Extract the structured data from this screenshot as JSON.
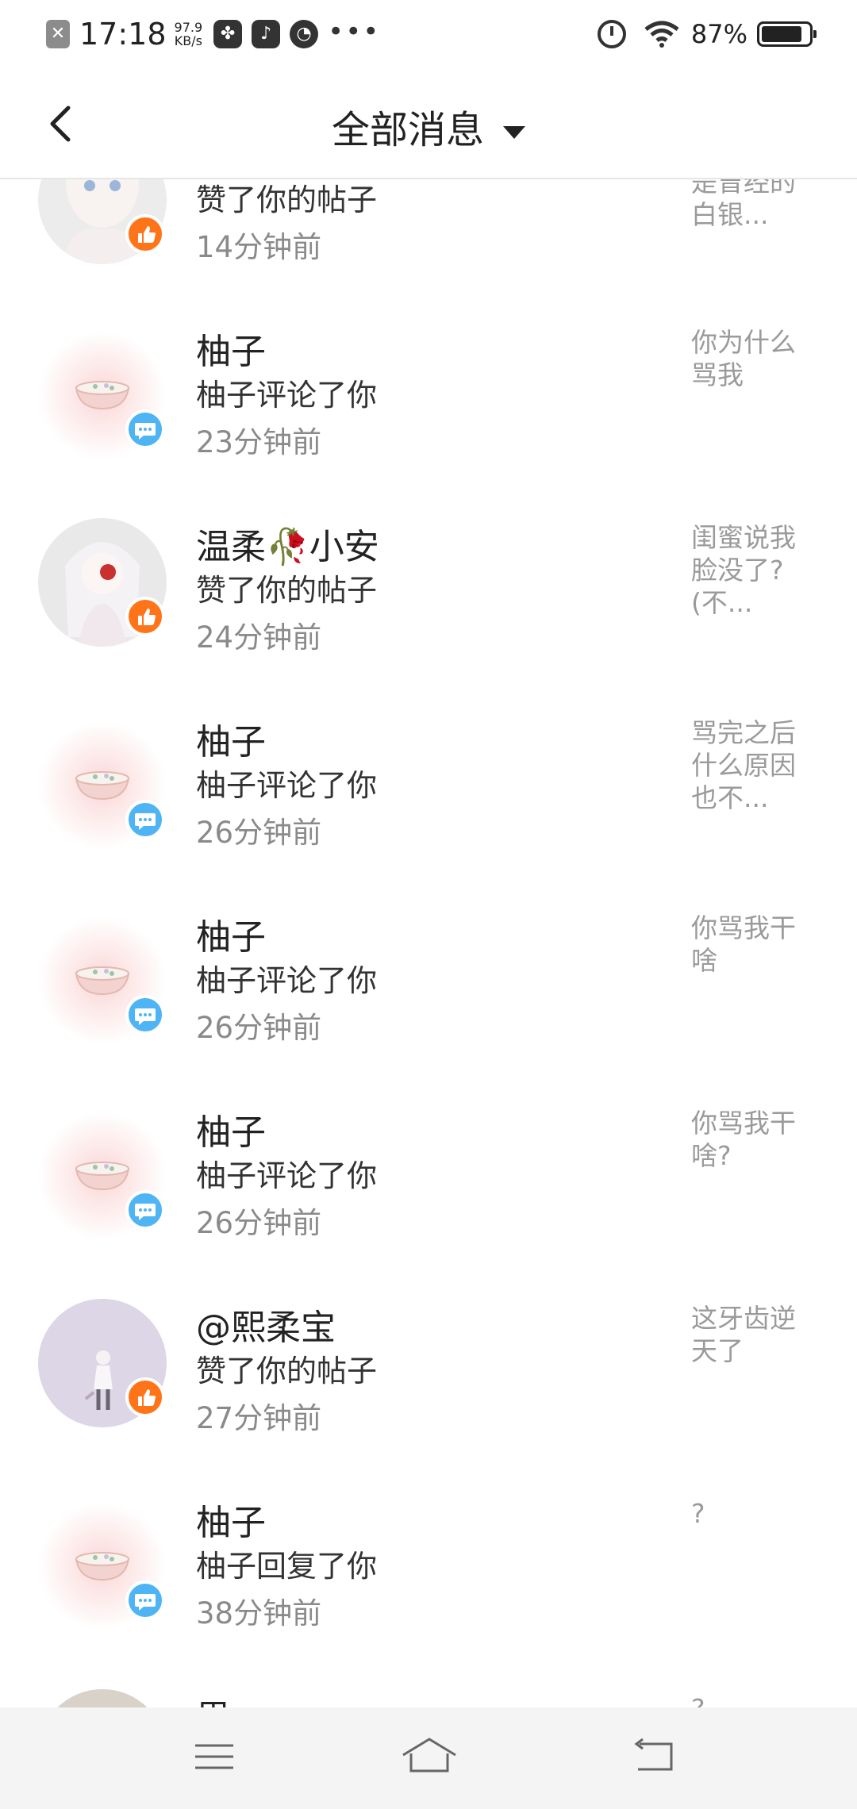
{
  "status_bar": {
    "time": "17:18",
    "speed_value": "97.9",
    "speed_unit": "KB/s",
    "battery": "87%",
    "battery_level": 0.87,
    "more": "•••",
    "icons": [
      "close-notification-icon",
      "pinwheel-app-icon",
      "music-app-icon",
      "chat-app-icon",
      "alarm-icon",
      "wifi-icon",
      "battery-icon"
    ]
  },
  "header": {
    "title": "全部消息",
    "back_icon": "chevron-left-icon",
    "filter_icon": "caret-down-icon"
  },
  "messages": [
    {
      "name": "",
      "action": "赞了你的帖子",
      "time": "14分钟前",
      "preview": "是曾经的白银...",
      "badge": "like"
    },
    {
      "name": "柚子",
      "action": "柚子评论了你",
      "time": "23分钟前",
      "preview": "你为什么骂我",
      "badge": "comment"
    },
    {
      "name": "温柔🥀小安",
      "action": "赞了你的帖子",
      "time": "24分钟前",
      "preview": "闺蜜说我脸没了?(不...",
      "badge": "like"
    },
    {
      "name": "柚子",
      "action": "柚子评论了你",
      "time": "26分钟前",
      "preview": "骂完之后什么原因也不...",
      "badge": "comment"
    },
    {
      "name": "柚子",
      "action": "柚子评论了你",
      "time": "26分钟前",
      "preview": "你骂我干啥",
      "badge": "comment"
    },
    {
      "name": "柚子",
      "action": "柚子评论了你",
      "time": "26分钟前",
      "preview": "你骂我干啥?",
      "badge": "comment"
    },
    {
      "name": "@熙柔宝",
      "action": "赞了你的帖子",
      "time": "27分钟前",
      "preview": "这牙齿逆天了",
      "badge": "like"
    },
    {
      "name": "柚子",
      "action": "柚子回复了你",
      "time": "38分钟前",
      "preview": "?",
      "badge": "comment"
    },
    {
      "name": "思一",
      "action": "",
      "time": "",
      "preview": "?",
      "badge": ""
    }
  ],
  "nav": {
    "icons": [
      "menu-icon",
      "home-icon",
      "back-icon"
    ]
  },
  "colors": {
    "like_badge": "#ff7418",
    "comment_badge": "#4fb4f3",
    "time_text": "#8a8a8a",
    "preview_text": "#9a9a9a"
  }
}
